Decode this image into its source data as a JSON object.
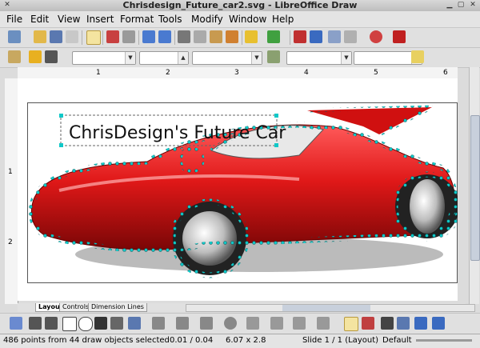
{
  "window": {
    "title": "Chrisdesign_Future_car2.svg - LibreOffice Draw"
  },
  "menu": [
    "File",
    "Edit",
    "View",
    "Insert",
    "Format",
    "Tools",
    "Modify",
    "Window",
    "Help"
  ],
  "ruler": {
    "h_ticks": [
      "1",
      "2",
      "3",
      "4",
      "5",
      "6"
    ],
    "v_ticks": [
      "1",
      "2"
    ]
  },
  "drawing": {
    "headline": "ChrisDesign's Future Car"
  },
  "tabs": [
    "Layout",
    "Controls",
    "Dimension Lines"
  ],
  "status": {
    "selection": "486 points from 44 draw objects selected",
    "position": "0.01 / 0.04",
    "size": "6.07 x 2.8",
    "slide": "Slide 1 / 1 (Layout)",
    "master": "Default"
  },
  "colors": {
    "car": "#e01818",
    "handle": "#10c8c8",
    "accent": "#2a6acb"
  }
}
